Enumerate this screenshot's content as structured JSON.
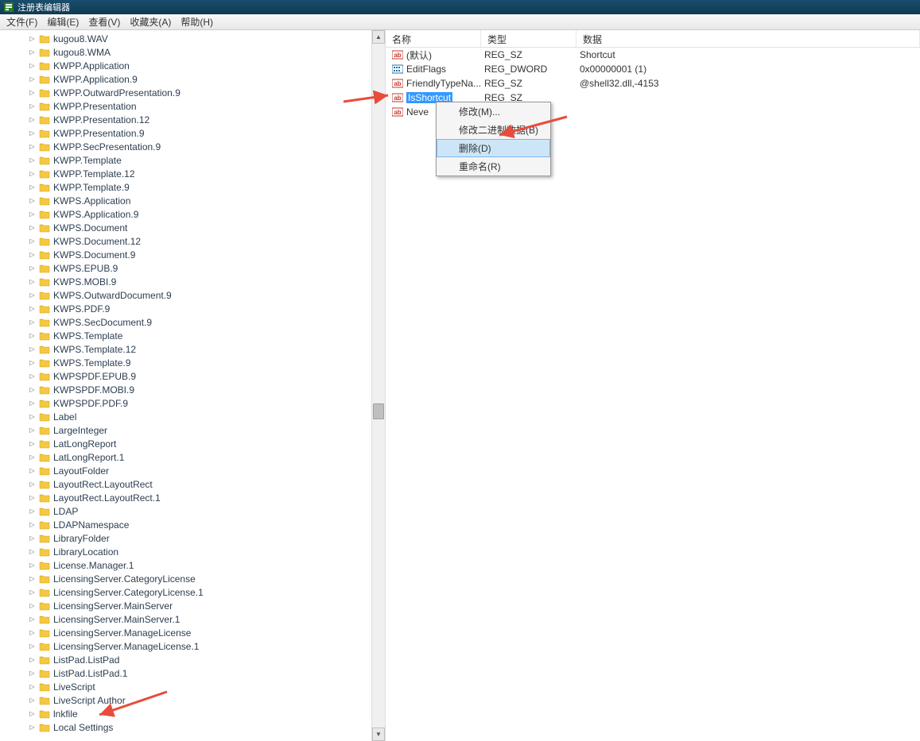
{
  "window": {
    "title": "注册表编辑器"
  },
  "menubar": {
    "items": [
      {
        "label": "文件(F)"
      },
      {
        "label": "编辑(E)"
      },
      {
        "label": "查看(V)"
      },
      {
        "label": "收藏夹(A)"
      },
      {
        "label": "帮助(H)"
      }
    ]
  },
  "tree": {
    "items": [
      "kugou8.WAV",
      "kugou8.WMA",
      "KWPP.Application",
      "KWPP.Application.9",
      "KWPP.OutwardPresentation.9",
      "KWPP.Presentation",
      "KWPP.Presentation.12",
      "KWPP.Presentation.9",
      "KWPP.SecPresentation.9",
      "KWPP.Template",
      "KWPP.Template.12",
      "KWPP.Template.9",
      "KWPS.Application",
      "KWPS.Application.9",
      "KWPS.Document",
      "KWPS.Document.12",
      "KWPS.Document.9",
      "KWPS.EPUB.9",
      "KWPS.MOBI.9",
      "KWPS.OutwardDocument.9",
      "KWPS.PDF.9",
      "KWPS.SecDocument.9",
      "KWPS.Template",
      "KWPS.Template.12",
      "KWPS.Template.9",
      "KWPSPDF.EPUB.9",
      "KWPSPDF.MOBI.9",
      "KWPSPDF.PDF.9",
      "Label",
      "LargeInteger",
      "LatLongReport",
      "LatLongReport.1",
      "LayoutFolder",
      "LayoutRect.LayoutRect",
      "LayoutRect.LayoutRect.1",
      "LDAP",
      "LDAPNamespace",
      "LibraryFolder",
      "LibraryLocation",
      "License.Manager.1",
      "LicensingServer.CategoryLicense",
      "LicensingServer.CategoryLicense.1",
      "LicensingServer.MainServer",
      "LicensingServer.MainServer.1",
      "LicensingServer.ManageLicense",
      "LicensingServer.ManageLicense.1",
      "ListPad.ListPad",
      "ListPad.ListPad.1",
      "LiveScript",
      "LiveScript Author",
      "lnkfile",
      "Local Settings"
    ]
  },
  "list": {
    "columns": {
      "name": "名称",
      "type": "类型",
      "data": "数据"
    },
    "rows": [
      {
        "icon": "string",
        "name": "(默认)",
        "type": "REG_SZ",
        "data": "Shortcut",
        "selected": false
      },
      {
        "icon": "binary",
        "name": "EditFlags",
        "type": "REG_DWORD",
        "data": "0x00000001 (1)",
        "selected": false
      },
      {
        "icon": "string",
        "name": "FriendlyTypeNa...",
        "type": "REG_SZ",
        "data": "@shell32.dll,-4153",
        "selected": false
      },
      {
        "icon": "string",
        "name": "IsShortcut",
        "type": "REG_SZ",
        "data": "",
        "selected": true
      },
      {
        "icon": "string",
        "name": "Neve",
        "type": "",
        "data": "",
        "selected": false
      }
    ]
  },
  "context_menu": {
    "items": [
      {
        "label": "修改(M)...",
        "hover": false
      },
      {
        "label": "修改二进制数据(B)",
        "hover": false
      },
      {
        "label": "删除(D)",
        "hover": true
      },
      {
        "label": "重命名(R)",
        "hover": false
      }
    ]
  }
}
